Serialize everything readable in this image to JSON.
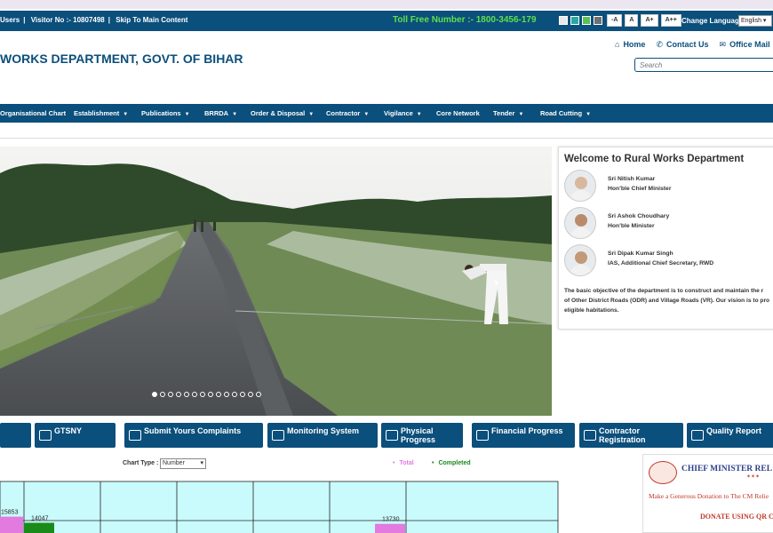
{
  "colors": {
    "primary": "#0b4f7c",
    "tollfree": "#5ee04a",
    "total": "#e27ae0",
    "completed": "#1a8a1a",
    "chart_bg": "#c9fbfd",
    "cm_red": "#c0392b",
    "cm_blue": "#2b3f8a"
  },
  "utility": {
    "users": "Users",
    "visitor_no": "Visitor No :- 10807498",
    "skip": "Skip To Main Content",
    "tollfree": "Toll Free Number :- 1800-3456-179",
    "theme_swatches": [
      "#e8e8e8",
      "#2aa7a2",
      "#5cc05a",
      "#707070"
    ],
    "font_buttons": [
      "-A",
      "A",
      "A+",
      "A++"
    ],
    "change_language": "Change Language",
    "language_selected": "English"
  },
  "header": {
    "title": "WORKS DEPARTMENT, GOVT. OF BIHAR",
    "links": [
      {
        "icon": "home-icon",
        "label": "Home"
      },
      {
        "icon": "phone-icon",
        "label": "Contact Us"
      },
      {
        "icon": "mail-icon",
        "label": "Office Mail"
      }
    ],
    "search_placeholder": "Search"
  },
  "nav": [
    {
      "label": "Organisational Chart",
      "dropdown": false
    },
    {
      "label": "Establishment",
      "dropdown": true
    },
    {
      "label": "Publications",
      "dropdown": true
    },
    {
      "label": "BRRDA",
      "dropdown": true
    },
    {
      "label": "Order & Disposal",
      "dropdown": true
    },
    {
      "label": "Contractor",
      "dropdown": true
    },
    {
      "label": "Vigilance",
      "dropdown": true
    },
    {
      "label": "Core Network",
      "dropdown": false
    },
    {
      "label": "Tender",
      "dropdown": true
    },
    {
      "label": "Road Cutting",
      "dropdown": true
    }
  ],
  "slider": {
    "dot_count": 14,
    "active_index": 0,
    "next_glyph": "›"
  },
  "welcome": {
    "title": "Welcome to Rural Works Department",
    "people": [
      {
        "name": "Sri Nitish Kumar",
        "role": "Hon'ble Chief Minister"
      },
      {
        "name": "Sri Ashok Choudhary",
        "role": "Hon'ble Minister"
      },
      {
        "name": "Sri Dipak Kumar Singh",
        "role": "IAS, Additional Chief Secretary, RWD"
      }
    ],
    "text_lines": [
      "The basic objective of the department is to construct and maintain the r",
      "of Other District Roads (ODR) and Village Roads (VR). Our vision is to pro",
      "eligible habitations."
    ]
  },
  "quick_buttons": [
    {
      "label": ""
    },
    {
      "label": "GTSNY"
    },
    {
      "label": "Submit Yours Complaints"
    },
    {
      "label": "Monitoring System"
    },
    {
      "label": "Physical\nProgress"
    },
    {
      "label": "Financial Progress"
    },
    {
      "label": "Contractor\nRegistration"
    },
    {
      "label": "Quality Report"
    }
  ],
  "chart_type": {
    "label": "Chart Type :",
    "selected": "Number"
  },
  "chart_data": {
    "type": "bar",
    "title": "",
    "xlabel": "",
    "ylabel": "",
    "categories": [
      "",
      "",
      "",
      "",
      "",
      "",
      ""
    ],
    "series": [
      {
        "name": "Total",
        "values": [
          15853,
          null,
          null,
          null,
          null,
          null,
          null
        ]
      },
      {
        "name": "Completed",
        "values": [
          null,
          14047,
          null,
          null,
          null,
          13730,
          null
        ]
      }
    ],
    "labels": [
      "15853",
      "14047",
      "13730"
    ],
    "grid": true,
    "legend": "top"
  },
  "cm_relief": {
    "title": "CHIEF MINISTER REL",
    "stars": "✶✶✶",
    "tagline": "Make a Generous Donation to The CM Relie",
    "donate": "DONATE USING QR CO"
  }
}
